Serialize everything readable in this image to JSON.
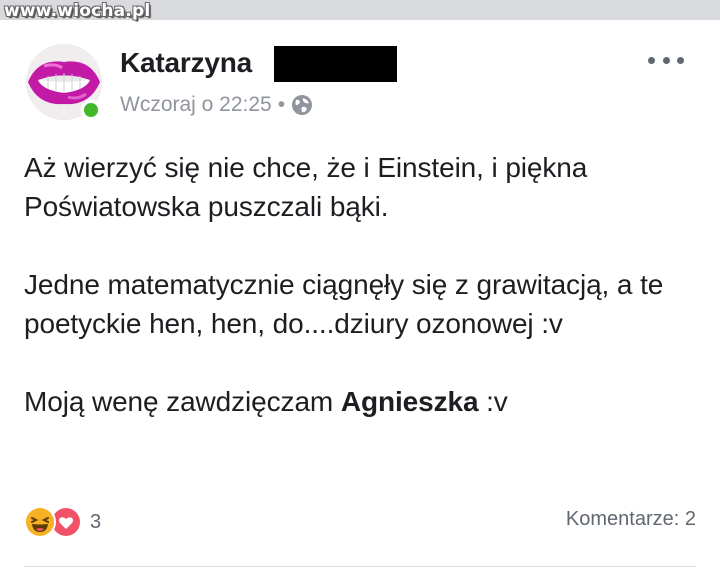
{
  "watermark": "www.wiocha.pl",
  "post": {
    "author": "Katarzyna",
    "timestamp": "Wczoraj o 22:25",
    "separator": "•",
    "privacy_icon": "globe-icon",
    "options_icon": "more-horizontal-icon",
    "paragraph_1": "Aż wierzyć się nie chce, że i Einstein, i piękna Poświatowska puszczali bąki.",
    "paragraph_2": "Jedne matematycznie ciągnęły się z grawitacją, a te poetyckie hen, hen, do....dziury ozonowej :v",
    "paragraph_3_prefix": "Moją wenę zawdzięczam ",
    "mention": "Agnieszka",
    "paragraph_3_suffix": " :v"
  },
  "reactions": {
    "icons": [
      "haha-icon",
      "love-icon"
    ],
    "count": "3"
  },
  "comments_label": "Komentarze: 2",
  "colors": {
    "online": "#42b72a",
    "love": "#f25268",
    "haha": "#f7b125",
    "meta_text": "#90949c"
  }
}
